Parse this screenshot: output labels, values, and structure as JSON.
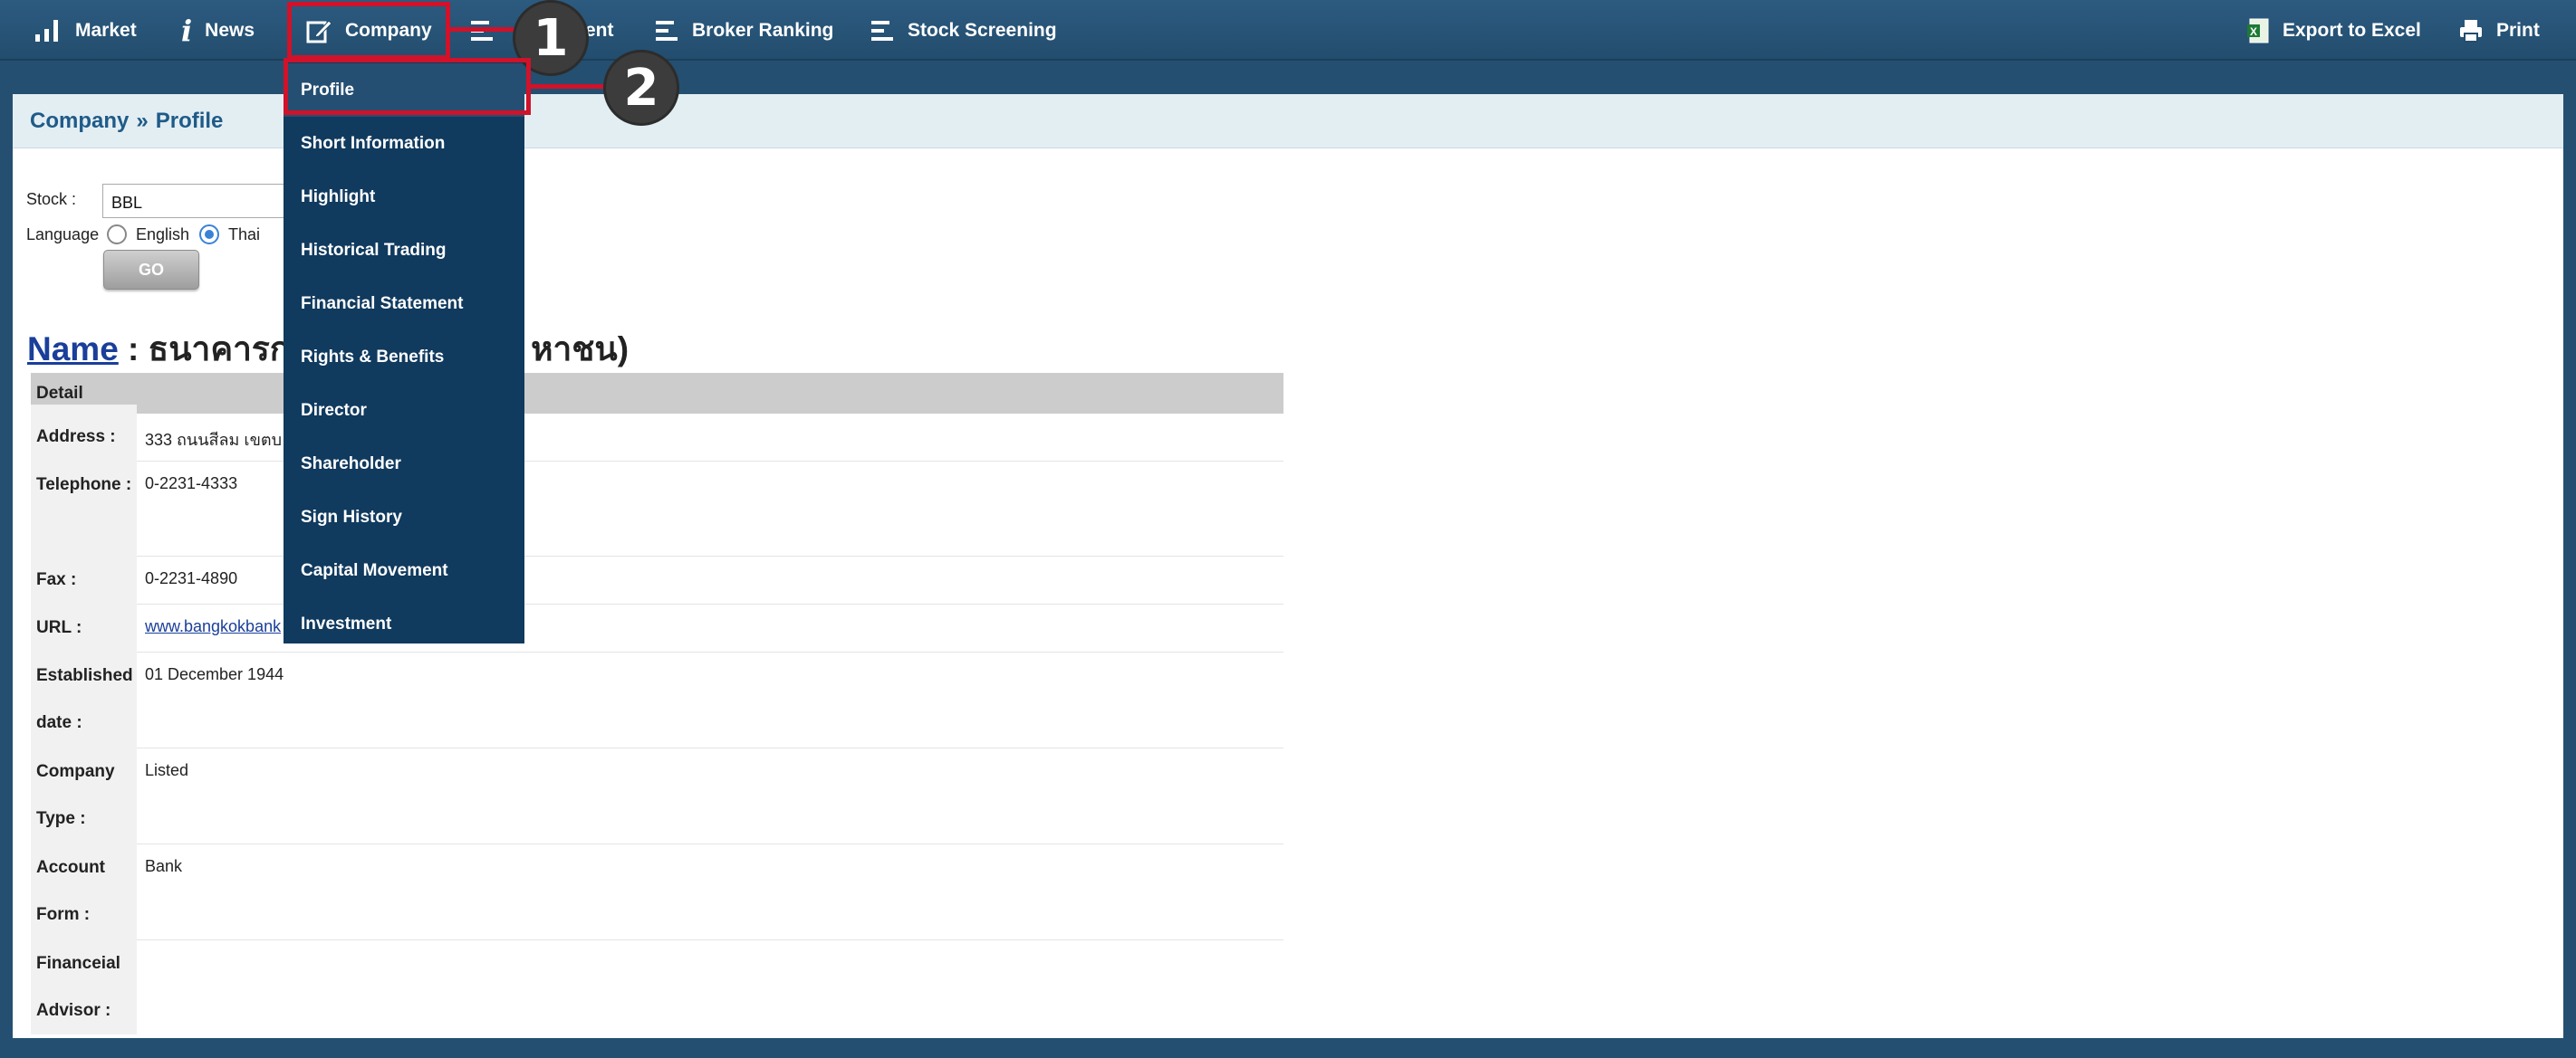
{
  "topnav": {
    "market": "Market",
    "news": "News",
    "company": "Company",
    "statement": "ent",
    "broker_ranking": "Broker Ranking",
    "stock_screening": "Stock Screening",
    "export_excel": "Export to Excel",
    "print": "Print"
  },
  "breadcrumb": {
    "section": "Company",
    "separator": "»",
    "page": "Profile"
  },
  "form": {
    "stock_label": "Stock :",
    "stock_value": "BBL",
    "language_label": "Language",
    "lang_english": "English",
    "lang_thai": "Thai",
    "selected_language": "Thai",
    "go_label": "GO"
  },
  "name_line": {
    "label": "Name",
    "sep": " : ",
    "value_left": "ธนาคารก",
    "value_right": "หาชน)"
  },
  "detail": {
    "header": "Detail",
    "rows": [
      {
        "label": "Address :",
        "value": "333 ถนนสีลม เขตบ"
      },
      {
        "label": "Telephone :",
        "value": "0-2231-4333"
      },
      {
        "label": "Fax :",
        "value": "0-2231-4890"
      },
      {
        "label": "URL :",
        "value": "www.bangkokbank"
      },
      {
        "label": "Established date :",
        "value": "01 December 1944"
      },
      {
        "label": "Company Type :",
        "value": "Listed"
      },
      {
        "label": "Account Form :",
        "value": "Bank"
      },
      {
        "label": "Financeial Advisor :",
        "value": ""
      }
    ]
  },
  "dropdown": {
    "items": [
      "Profile",
      "Short Information",
      "Highlight",
      "Historical Trading",
      "Financial Statement",
      "Rights & Benefits",
      "Director",
      "Shareholder",
      "Sign History",
      "Capital Movement",
      "Investment"
    ],
    "active": "Profile"
  },
  "callouts": [
    "1",
    "2"
  ],
  "colors": {
    "nav_bg": "#2c5b80",
    "dropdown_bg": "#103a5e",
    "highlight_red": "#d0122a",
    "breadcrumb": "#1f5b88",
    "link": "#1a3f9a"
  }
}
